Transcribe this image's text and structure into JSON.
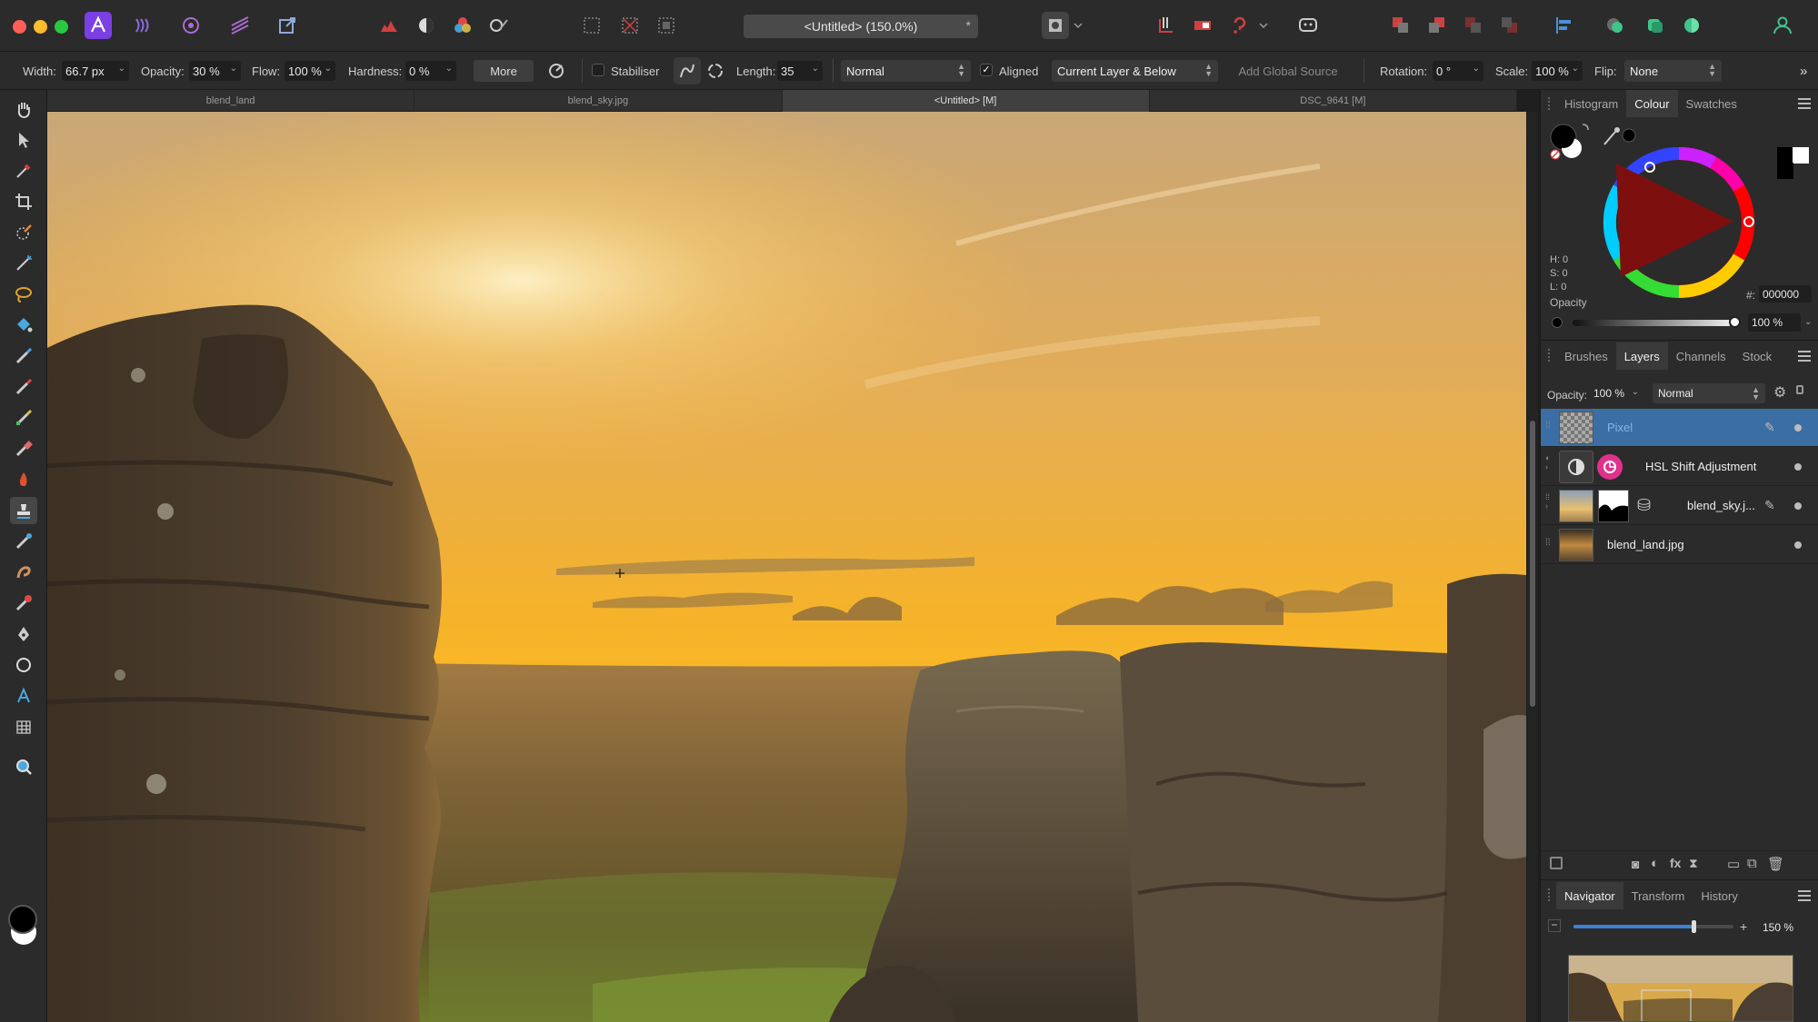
{
  "app": {
    "document_title": "<Untitled> (150.0%)",
    "title_star": "*"
  },
  "context_toolbar": {
    "width_label": "Width:",
    "width_value": "66.7 px",
    "opacity_label": "Opacity:",
    "opacity_value": "30 %",
    "flow_label": "Flow:",
    "flow_value": "100 %",
    "hardness_label": "Hardness:",
    "hardness_value": "0 %",
    "more_label": "More",
    "stabiliser_label": "Stabiliser",
    "length_label": "Length:",
    "length_value": "35",
    "blend_mode": "Normal",
    "aligned_label": "Aligned",
    "aligned_check": "✓",
    "source_value": "Current Layer & Below",
    "add_global_source_label": "Add Global Source",
    "rotation_label": "Rotation:",
    "rotation_value": "0 °",
    "scale_label": "Scale:",
    "scale_value": "100 %",
    "flip_label": "Flip:",
    "flip_value": "None"
  },
  "document_tabs": [
    {
      "label": "blend_land"
    },
    {
      "label": "blend_sky.jpg"
    },
    {
      "label": "<Untitled> [M]"
    },
    {
      "label": "DSC_9641 [M]"
    }
  ],
  "colour_panel": {
    "tabs": [
      "Histogram",
      "Colour",
      "Swatches"
    ],
    "h_label": "H: 0",
    "s_label": "S: 0",
    "l_label": "L: 0",
    "hex_label": "#:",
    "hex_value": "000000",
    "opacity_label": "Opacity",
    "opacity_value": "100 %"
  },
  "layers_panel": {
    "tabs": [
      "Brushes",
      "Layers",
      "Channels",
      "Stock"
    ],
    "opacity_label": "Opacity:",
    "opacity_value": "100 %",
    "blend_mode": "Normal",
    "layers": [
      {
        "name": "Pixel"
      },
      {
        "name": "HSL Shift Adjustment"
      },
      {
        "name": "blend_sky.j..."
      },
      {
        "name": "blend_land.jpg"
      }
    ]
  },
  "navigator_panel": {
    "tabs": [
      "Navigator",
      "Transform",
      "History"
    ],
    "zoom_value": "150 %",
    "zoom_fraction": 0.75
  },
  "colors": {
    "accent": "#3b6ea5",
    "app_icon": "#7b3fe4",
    "selected_layer": "#3b6ea5",
    "hsl_icon": "#e0328c"
  }
}
